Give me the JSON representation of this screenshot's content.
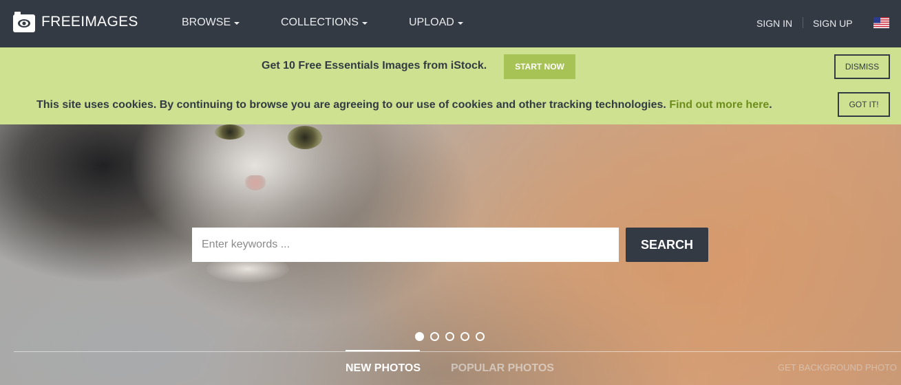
{
  "header": {
    "logo_text": "FREEIMAGES",
    "nav": [
      {
        "label": "BROWSE"
      },
      {
        "label": "COLLECTIONS"
      },
      {
        "label": "UPLOAD"
      }
    ],
    "sign_in": "SIGN IN",
    "sign_up": "SIGN UP",
    "language_icon": "us-flag-icon"
  },
  "istock_banner": {
    "text": "Get 10 Free Essentials Images from iStock.",
    "start_label": "START NOW",
    "dismiss_label": "DISMISS"
  },
  "cookie_banner": {
    "text": "This site uses cookies. By continuing to browse you are agreeing to our use of cookies and other tracking technologies.",
    "link_text": "Find out more here",
    "link_suffix": ".",
    "gotit_label": "GOT IT!"
  },
  "hero": {
    "search_placeholder": "Enter keywords ...",
    "search_label": "SEARCH",
    "slide_count": 5,
    "active_slide": 1,
    "tabs": [
      {
        "label": "NEW PHOTOS",
        "active": true
      },
      {
        "label": "POPULAR PHOTOS",
        "active": false
      }
    ],
    "bg_link": "GET BACKGROUND PHOTO"
  },
  "colors": {
    "navbar": "#343a44",
    "banner": "#cde190",
    "accent_green": "#a7c356",
    "link_green": "#6d8e1c"
  }
}
